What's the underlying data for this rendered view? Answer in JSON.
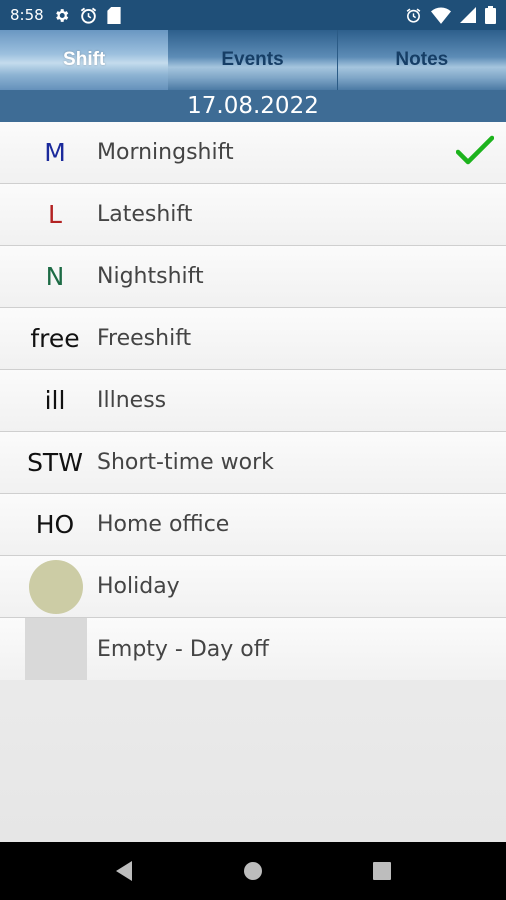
{
  "status_bar": {
    "time": "8:58",
    "left_icons": [
      "gear-icon",
      "alarm-icon",
      "sd-card-icon"
    ],
    "right_icons": [
      "alarm-icon",
      "wifi-icon",
      "signal-icon",
      "battery-icon"
    ]
  },
  "tabs": [
    {
      "label": "Shift",
      "active": true
    },
    {
      "label": "Events",
      "active": false
    },
    {
      "label": "Notes",
      "active": false
    }
  ],
  "date": "17.08.2022",
  "shifts": [
    {
      "code": "M",
      "label": "Morningshift",
      "code_color": "#1b2a9c",
      "selected": true
    },
    {
      "code": "L",
      "label": "Lateshift",
      "code_color": "#b32222",
      "selected": false
    },
    {
      "code": "N",
      "label": "Nightshift",
      "code_color": "#1d6b45",
      "selected": false
    },
    {
      "code": "free",
      "label": "Freeshift",
      "code_color": "#111111",
      "selected": false
    },
    {
      "code": "ill",
      "label": "Illness",
      "code_color": "#111111",
      "selected": false
    },
    {
      "code": "STW",
      "label": "Short-time work",
      "code_color": "#111111",
      "selected": false
    },
    {
      "code": "HO",
      "label": "Home office",
      "code_color": "#111111",
      "selected": false
    },
    {
      "code": "",
      "label": "Holiday",
      "marker": "circle",
      "marker_color": "#cccca5",
      "selected": false
    },
    {
      "code": "",
      "label": "Empty - Day off",
      "marker": "square",
      "marker_color": "#d9d9d9",
      "selected": false
    }
  ],
  "colors": {
    "check": "#1db31d",
    "status_bar": "#1f4f78",
    "date_header": "#3e6c95"
  },
  "nav_bar": [
    "back-icon",
    "home-icon",
    "recents-icon"
  ]
}
